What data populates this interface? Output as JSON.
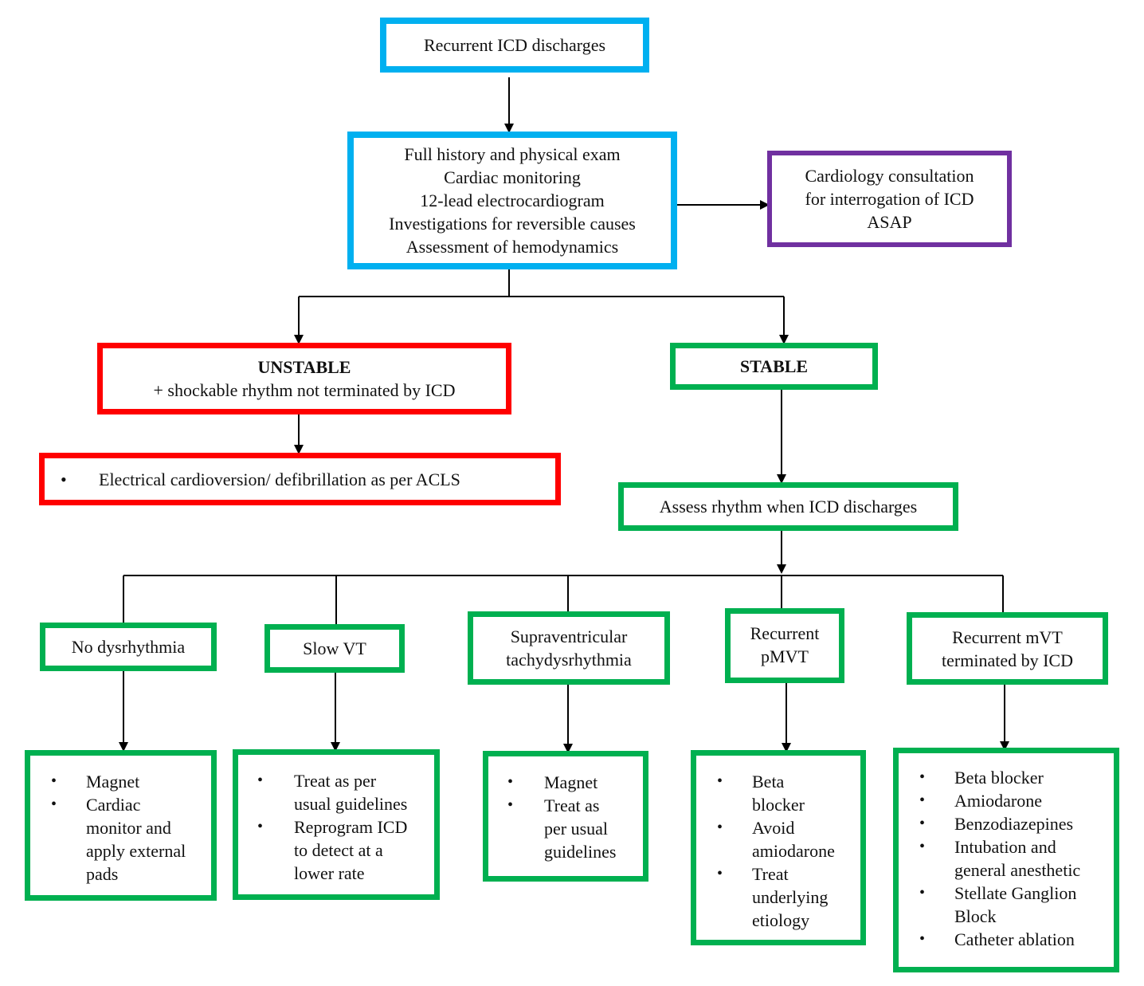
{
  "flowchart": {
    "start": "Recurrent ICD discharges",
    "assessment": [
      "Full history and physical exam",
      "Cardiac monitoring",
      "12-lead electrocardiogram",
      "Investigations for reversible causes",
      "Assessment of hemodynamics"
    ],
    "consult": [
      "Cardiology consultation",
      "for interrogation of ICD",
      "ASAP"
    ],
    "unstable": {
      "title": "UNSTABLE",
      "subtitle": "+ shockable rhythm not terminated by ICD",
      "action": "Electrical cardioversion/ defibrillation as per ACLS"
    },
    "stable": {
      "title": "STABLE",
      "assess": "Assess rhythm when ICD discharges"
    },
    "branches": [
      {
        "label": [
          "No dysrhythmia"
        ],
        "actions": [
          [
            "Magnet"
          ],
          [
            "Cardiac",
            "monitor and",
            "apply external",
            "pads"
          ]
        ]
      },
      {
        "label": [
          "Slow VT"
        ],
        "actions": [
          [
            "Treat as per",
            "usual guidelines"
          ],
          [
            "Reprogram ICD",
            "to detect at a",
            "lower rate"
          ]
        ]
      },
      {
        "label": [
          "Supraventricular",
          "tachydysrhythmia"
        ],
        "actions": [
          [
            "Magnet"
          ],
          [
            "Treat as",
            "per usual",
            "guidelines"
          ]
        ]
      },
      {
        "label": [
          "Recurrent",
          "pMVT"
        ],
        "actions": [
          [
            "Beta",
            "blocker"
          ],
          [
            "Avoid",
            "amiodarone"
          ],
          [
            "Treat",
            "underlying",
            "etiology"
          ]
        ]
      },
      {
        "label": [
          "Recurrent mVT",
          "terminated by ICD"
        ],
        "actions": [
          [
            "Beta blocker"
          ],
          [
            "Amiodarone"
          ],
          [
            "Benzodiazepines"
          ],
          [
            "Intubation and",
            "general anesthetic"
          ],
          [
            "Stellate Ganglion",
            "Block"
          ],
          [
            "Catheter ablation"
          ]
        ]
      }
    ],
    "bullet_glyph": "•",
    "colors": {
      "blue": "#00b0f0",
      "purple": "#7030a0",
      "red": "#ff0000",
      "green": "#00b050"
    }
  }
}
